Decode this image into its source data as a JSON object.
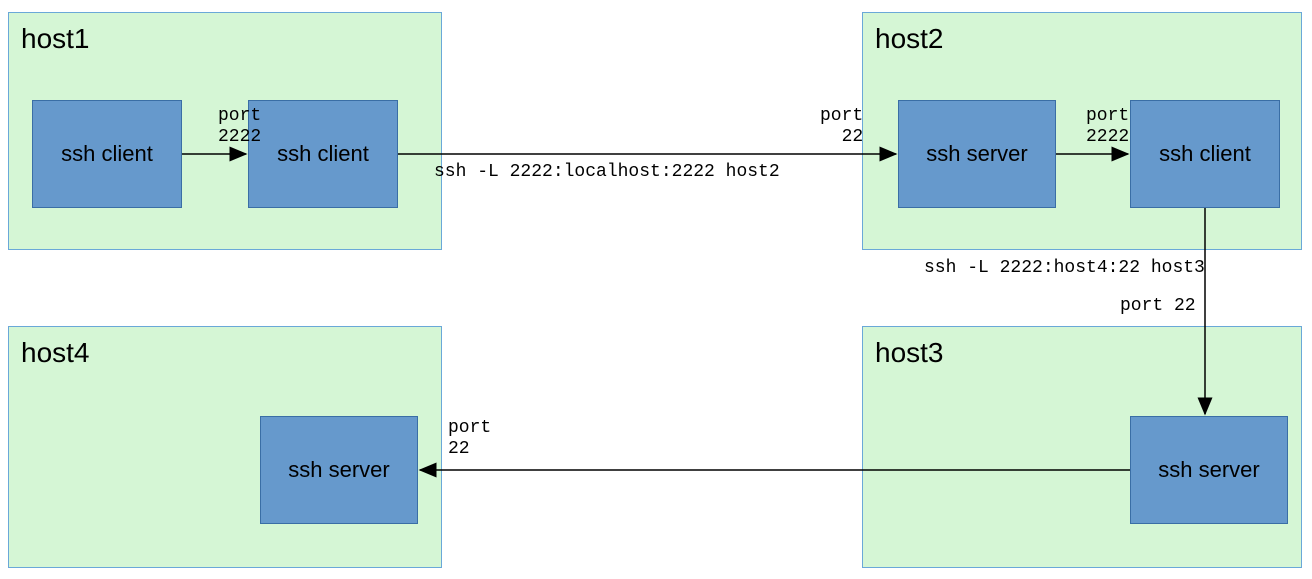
{
  "hosts": {
    "host1": {
      "title": "host1"
    },
    "host2": {
      "title": "host2"
    },
    "host3": {
      "title": "host3"
    },
    "host4": {
      "title": "host4"
    }
  },
  "nodes": {
    "h1_client_a": "ssh client",
    "h1_client_b": "ssh client",
    "h2_server": "ssh server",
    "h2_client": "ssh client",
    "h3_server": "ssh server",
    "h4_server": "ssh server"
  },
  "ports": {
    "p_h1_2222": "port\n2222",
    "p_h2_22": "port\n22",
    "p_h2_2222": "port\n2222",
    "p_h3_22": "port 22",
    "p_h4_22": "port\n22"
  },
  "commands": {
    "tunnel1": "ssh -L 2222:localhost:2222 host2",
    "tunnel2": "ssh -L 2222:host4:22 host3"
  },
  "colors": {
    "host_fill": "#d5f6d5",
    "host_border": "#6aa8d8",
    "node_fill": "#6699cc",
    "node_border": "#3a6ea5"
  },
  "diagram": "SSH multi-hop local port forwarding through host2 and host3 to reach host4"
}
